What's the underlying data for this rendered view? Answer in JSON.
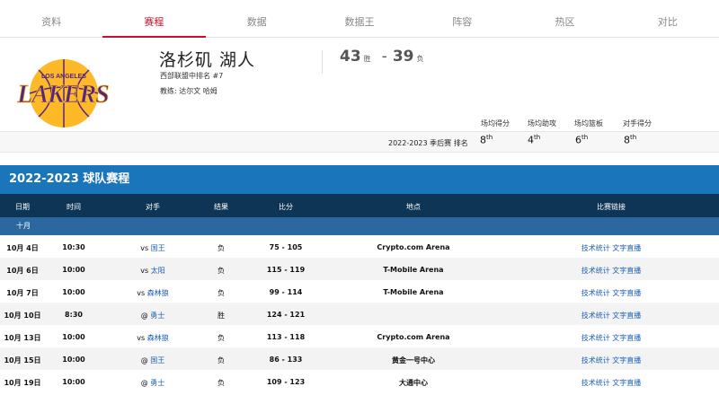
{
  "nav": {
    "items": [
      "资料",
      "赛程",
      "数据",
      "数据王",
      "阵容",
      "热区",
      "对比"
    ],
    "active_index": 1
  },
  "team": {
    "name": "洛杉矶 湖人",
    "rank": "西部联盟中排名 #7",
    "coach": "教练: 达尔文 哈姆",
    "wins": "43",
    "wins_label": "胜",
    "losses": "39",
    "losses_label": "负",
    "logo_text": "LOS ANGELES LAKERS"
  },
  "stats": {
    "caption": "2022-2023 季后赛 排名",
    "items": [
      {
        "label": "场均得分",
        "value": "8",
        "suffix": "th"
      },
      {
        "label": "场均助攻",
        "value": "4",
        "suffix": "th"
      },
      {
        "label": "场均篮板",
        "value": "6",
        "suffix": "th"
      },
      {
        "label": "对手得分",
        "value": "8",
        "suffix": "th"
      }
    ]
  },
  "schedule": {
    "title": "2022-2023 球队赛程",
    "columns": [
      "日期",
      "时间",
      "对手",
      "结果",
      "比分",
      "地点",
      "比赛链接"
    ],
    "month": "十月",
    "link_stats": "技术统计",
    "link_live": "文字直播",
    "rows": [
      {
        "date": "10月 4日",
        "time": "10:30",
        "prefix": "vs",
        "opponent": "国王",
        "result": "负",
        "score": "75 - 105",
        "venue": "Crypto.com Arena"
      },
      {
        "date": "10月 6日",
        "time": "10:00",
        "prefix": "vs",
        "opponent": "太阳",
        "result": "负",
        "score": "115 - 119",
        "venue": "T-Mobile Arena"
      },
      {
        "date": "10月 7日",
        "time": "10:00",
        "prefix": "vs",
        "opponent": "森林狼",
        "result": "负",
        "score": "99 - 114",
        "venue": "T-Mobile Arena"
      },
      {
        "date": "10月 10日",
        "time": "8:30",
        "prefix": "@",
        "opponent": "勇士",
        "result": "胜",
        "score": "124 - 121",
        "venue": ""
      },
      {
        "date": "10月 13日",
        "time": "10:00",
        "prefix": "vs",
        "opponent": "森林狼",
        "result": "负",
        "score": "113 - 118",
        "venue": "Crypto.com Arena"
      },
      {
        "date": "10月 15日",
        "time": "10:00",
        "prefix": "@",
        "opponent": "国王",
        "result": "负",
        "score": "86 - 133",
        "venue": "黄金一号中心"
      },
      {
        "date": "10月 19日",
        "time": "10:00",
        "prefix": "@",
        "opponent": "勇士",
        "result": "负",
        "score": "109 - 123",
        "venue": "大通中心"
      }
    ]
  },
  "colors": {
    "accent": "#c8102e",
    "title_bar": "#1a75bb",
    "header_bar": "#0e3456",
    "month_bar": "#2b68a0",
    "link": "#1a5fb4",
    "lakers_purple": "#552583",
    "lakers_gold": "#fdb927"
  }
}
